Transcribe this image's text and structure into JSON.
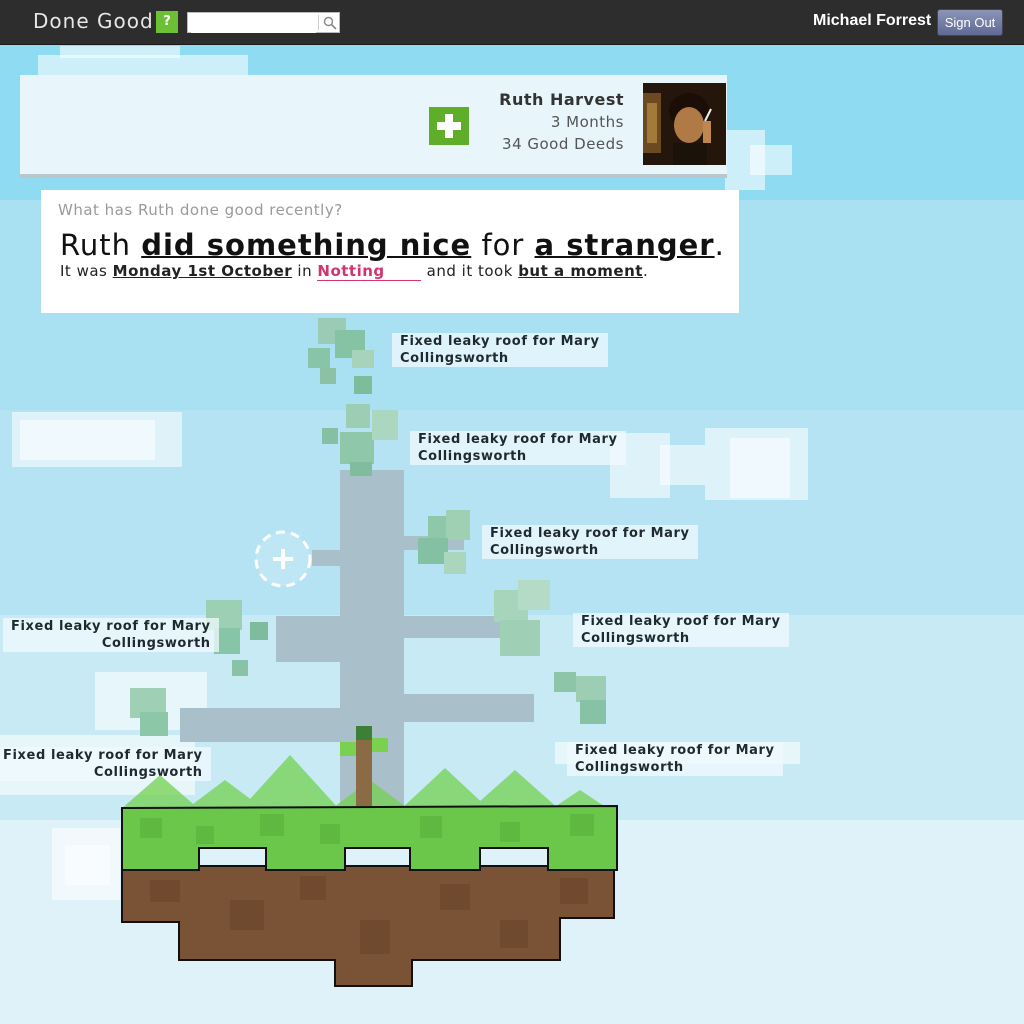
{
  "app": {
    "title": "Done Good",
    "help_label": "?"
  },
  "search": {
    "value": "",
    "placeholder": ""
  },
  "user": {
    "name": "Michael Forrest",
    "signout_label": "Sign Out"
  },
  "profile": {
    "name": "Ruth Harvest",
    "tenure": "3 Months",
    "deeds_count": "34 Good Deeds"
  },
  "deed_form": {
    "question": "What has Ruth done good recently?",
    "subject": "Ruth",
    "action": "did something nice",
    "connector": "for",
    "recipient": "a stranger",
    "period": ".",
    "it_was": "It was",
    "date": "Monday 1st October",
    "in_word": "in",
    "location_value": "Notting",
    "took": "and it took",
    "duration": "but a moment",
    "end": "."
  },
  "deeds": [
    {
      "line1": "Fixed leaky roof for Mary",
      "line2": "Collingsworth"
    },
    {
      "line1": "Fixed leaky roof for Mary",
      "line2": "Collingsworth"
    },
    {
      "line1": "Fixed leaky roof for Mary",
      "line2": "Collingsworth"
    },
    {
      "line1": "Fixed leaky roof for Mary",
      "line2": "Collingsworth"
    },
    {
      "line1": "Fixed leaky roof for Mary",
      "line2": "Collingsworth"
    },
    {
      "line1": "Fixed leaky roof for Mary",
      "line2": "Collingsworth"
    },
    {
      "line1": "Fixed leaky roof for Mary",
      "line2": "Collingsworth"
    }
  ],
  "colors": {
    "grass": "#6ac74a",
    "dirt": "#7a5236",
    "accent": "#5fae2a",
    "location": "#d3336e"
  },
  "icons": [
    "search-icon",
    "plus-icon",
    "add-deed-icon"
  ]
}
